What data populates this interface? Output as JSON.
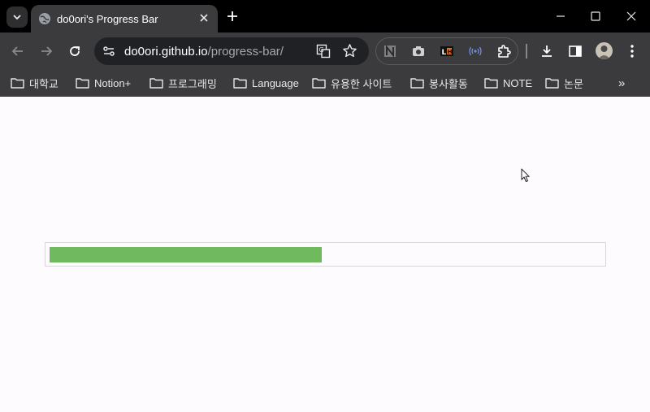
{
  "tab": {
    "title": "do0ori's Progress Bar"
  },
  "address": {
    "host": "do0ori.github.io",
    "path": "/progress-bar/"
  },
  "extensions": [
    "notion-icon",
    "camera-icon",
    "lh-extension-icon",
    "broadcast-icon"
  ],
  "bookmarks": {
    "items": [
      {
        "label": "대학교"
      },
      {
        "label": "Notion+"
      },
      {
        "label": "프로그래밍"
      },
      {
        "label": "Language"
      },
      {
        "label": "유용한 사이트"
      },
      {
        "label": "봉사활동"
      },
      {
        "label": "NOTE"
      },
      {
        "label": "논문"
      }
    ],
    "more": "»"
  },
  "progress": {
    "fraction": 0.494,
    "color": "#70b95e",
    "track_border": "#d6d6d6"
  },
  "theme": {
    "chrome_dark": "#3b3b3d",
    "tabstrip": "#000000",
    "omnibox": "#202124",
    "page_bg": "#fdfbfd"
  }
}
